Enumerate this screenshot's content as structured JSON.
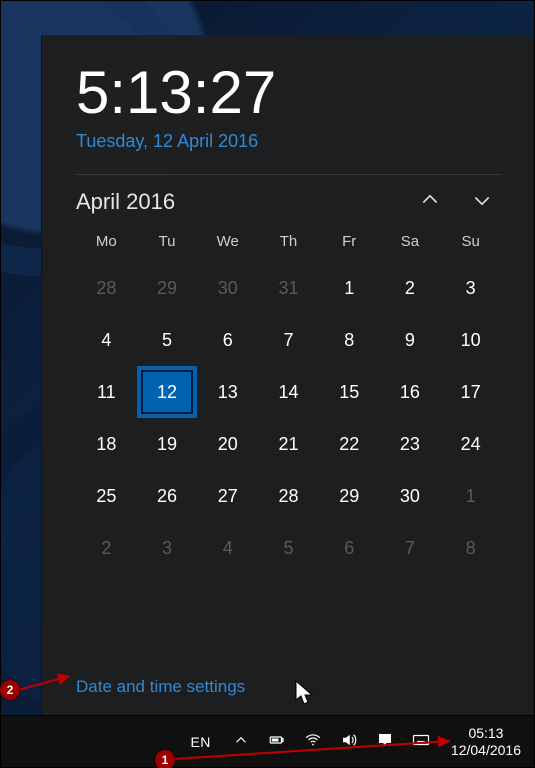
{
  "clock": {
    "time": "5:13:27",
    "long_date": "Tuesday, 12 April 2016"
  },
  "calendar": {
    "month_label": "April 2016",
    "dow": [
      "Mo",
      "Tu",
      "We",
      "Th",
      "Fr",
      "Sa",
      "Su"
    ],
    "weeks": [
      [
        {
          "n": "28",
          "m": false
        },
        {
          "n": "29",
          "m": false
        },
        {
          "n": "30",
          "m": false
        },
        {
          "n": "31",
          "m": false
        },
        {
          "n": "1",
          "m": true
        },
        {
          "n": "2",
          "m": true
        },
        {
          "n": "3",
          "m": true
        }
      ],
      [
        {
          "n": "4",
          "m": true
        },
        {
          "n": "5",
          "m": true
        },
        {
          "n": "6",
          "m": true
        },
        {
          "n": "7",
          "m": true
        },
        {
          "n": "8",
          "m": true
        },
        {
          "n": "9",
          "m": true
        },
        {
          "n": "10",
          "m": true
        }
      ],
      [
        {
          "n": "11",
          "m": true
        },
        {
          "n": "12",
          "m": true,
          "today": true
        },
        {
          "n": "13",
          "m": true
        },
        {
          "n": "14",
          "m": true
        },
        {
          "n": "15",
          "m": true
        },
        {
          "n": "16",
          "m": true
        },
        {
          "n": "17",
          "m": true
        }
      ],
      [
        {
          "n": "18",
          "m": true
        },
        {
          "n": "19",
          "m": true
        },
        {
          "n": "20",
          "m": true
        },
        {
          "n": "21",
          "m": true
        },
        {
          "n": "22",
          "m": true
        },
        {
          "n": "23",
          "m": true
        },
        {
          "n": "24",
          "m": true
        }
      ],
      [
        {
          "n": "25",
          "m": true
        },
        {
          "n": "26",
          "m": true
        },
        {
          "n": "27",
          "m": true
        },
        {
          "n": "28",
          "m": true
        },
        {
          "n": "29",
          "m": true
        },
        {
          "n": "30",
          "m": true
        },
        {
          "n": "1",
          "m": false
        }
      ],
      [
        {
          "n": "2",
          "m": false
        },
        {
          "n": "3",
          "m": false
        },
        {
          "n": "4",
          "m": false
        },
        {
          "n": "5",
          "m": false
        },
        {
          "n": "6",
          "m": false
        },
        {
          "n": "7",
          "m": false
        },
        {
          "n": "8",
          "m": false
        }
      ]
    ]
  },
  "links": {
    "settings": "Date and time settings"
  },
  "tray": {
    "language": "EN",
    "clock_time": "05:13",
    "clock_date": "12/04/2016"
  },
  "annotations": {
    "badge1": "1",
    "badge2": "2"
  }
}
